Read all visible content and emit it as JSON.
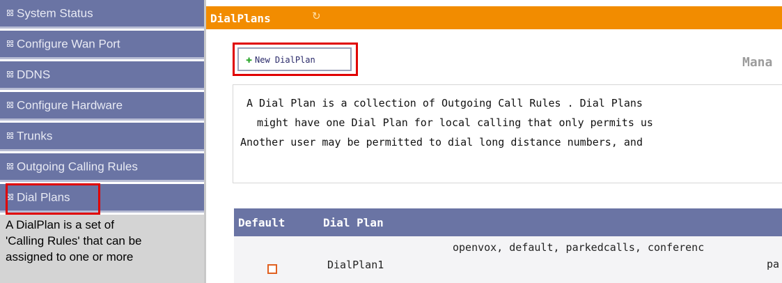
{
  "sidebar": {
    "items": [
      {
        "label": "System Status"
      },
      {
        "label": "Configure Wan Port"
      },
      {
        "label": "DDNS"
      },
      {
        "label": "Configure Hardware"
      },
      {
        "label": "Trunks"
      },
      {
        "label": "Outgoing Calling Rules"
      },
      {
        "label": "Dial Plans"
      }
    ],
    "description_lines": [
      "A DialPlan is a set of",
      "'Calling Rules' that can be",
      "assigned to one or more"
    ],
    "icon": "grid-icon"
  },
  "header": {
    "title": "DialPlans",
    "refresh_icon": "refresh-icon"
  },
  "toolbar": {
    "new_label": "New DialPlan",
    "manage_title": "Mana"
  },
  "description": {
    "lines": [
      "A Dial Plan is a collection of Outgoing Call Rules . Dial Plans",
      "might have one Dial Plan for local calling that only permits us",
      "Another user may be permitted to dial long distance numbers, and"
    ]
  },
  "table": {
    "headers": [
      "Default",
      "Dial Plan"
    ],
    "rows": [
      {
        "name": "DialPlan1",
        "rules_line1": "openvox, default, parkedcalls, conferenc",
        "rules_line2": "pa"
      }
    ]
  },
  "colors": {
    "sidebar_bg": "#6a74a4",
    "header_bg": "#f28c00",
    "highlight": "#e00000"
  }
}
